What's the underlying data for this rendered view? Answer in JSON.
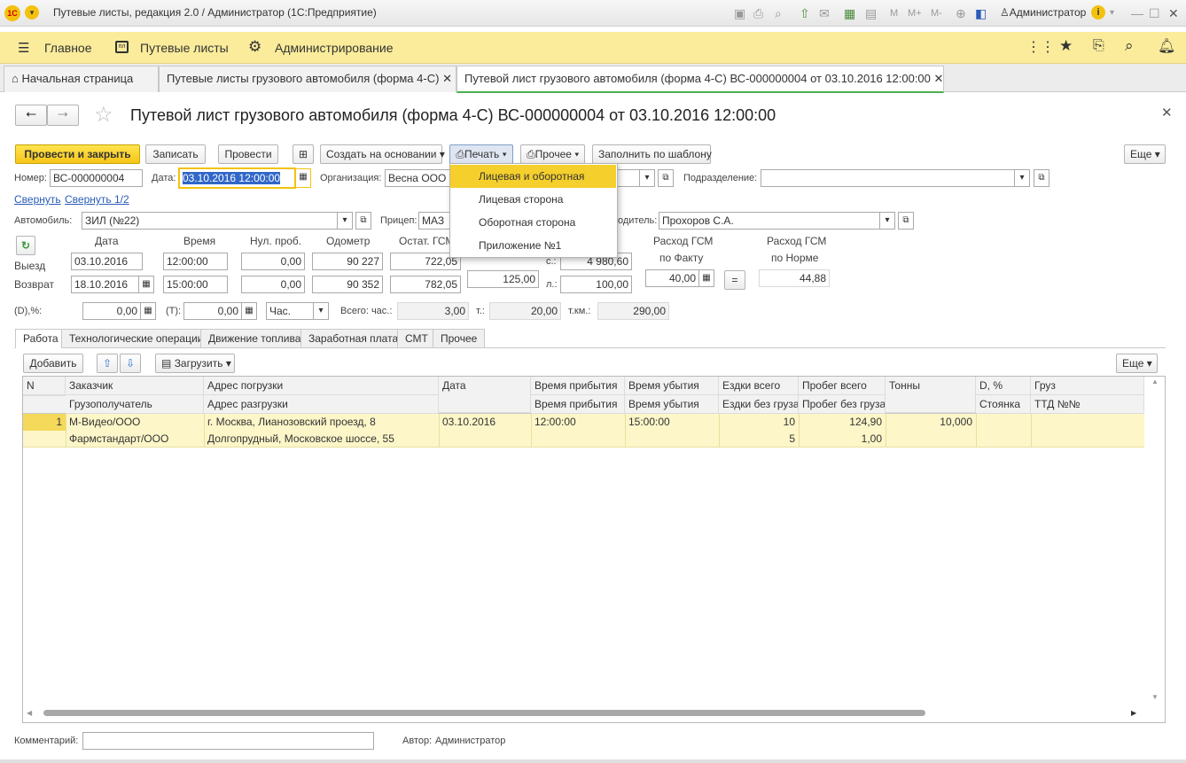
{
  "window": {
    "title": "Путевые листы, редакция 2.0 / Администратор (1С:Предприятие)",
    "user": "Администратор",
    "app_logo": "1С"
  },
  "menu": {
    "items": [
      "Главное",
      "Путевые листы",
      "Администрирование"
    ]
  },
  "tabs": {
    "home": "Начальная страница",
    "t1": "Путевые листы грузового автомобиля (форма 4-С)",
    "t2": "Путевой лист грузового автомобиля (форма 4-С) ВС-000000004 от 03.10.2016 12:00:00"
  },
  "doc": {
    "title": "Путевой лист грузового автомобиля (форма 4-С) ВС-000000004 от 03.10.2016 12:00:00"
  },
  "toolbar": {
    "post_close": "Провести и закрыть",
    "save": "Записать",
    "post": "Провести",
    "create_based": "Создать на основании",
    "print": "Печать",
    "other": "Прочее",
    "fill_template": "Заполнить по шаблону",
    "more": "Еще"
  },
  "print_menu": {
    "items": [
      "Лицевая и оборотная",
      "Лицевая сторона",
      "Оборотная сторона",
      "Приложение №1"
    ]
  },
  "fields": {
    "number_label": "Номер:",
    "number": "ВС-000000004",
    "date_label": "Дата:",
    "date": "03.10.2016 12:00:00",
    "org_label": "Организация:",
    "org": "Весна ООО",
    "dept_label": "Подразделение:",
    "dept": "",
    "collapse": "Свернуть",
    "collapse_half": "Свернуть 1/2",
    "car_label": "Автомобиль:",
    "car": "ЗИЛ (№22)",
    "trailer_label": "Прицеп:",
    "trailer": "МАЗ",
    "driver_label": "одитель:",
    "driver": "Прохоров С.А."
  },
  "trip": {
    "h_date": "Дата",
    "h_time": "Время",
    "h_zero": "Нул. проб.",
    "h_odo": "Одометр",
    "h_fuel": "Остат. ГСМ",
    "h_fact1": "Расход ГСМ",
    "h_fact2": "по Факту",
    "h_norm1": "Расход ГСМ",
    "h_norm2": "по Норме",
    "out_label": "Выезд",
    "out_date": "03.10.2016",
    "out_time": "12:00:00",
    "out_zero": "0,00",
    "out_odo": "90 227",
    "out_fuel": "722,05",
    "ret_label": "Возврат",
    "ret_date": "18.10.2016",
    "ret_time": "15:00:00",
    "ret_zero": "0,00",
    "ret_odo": "90 352",
    "ret_fuel": "782,05",
    "mid_val": "125,00",
    "s_label": "с.:",
    "s_val": "4 980,60",
    "l_label": "л.:",
    "l_val": "100,00",
    "fact_val": "40,00",
    "eq": "=",
    "norm_val": "44,88"
  },
  "summary": {
    "d_label": "(D),%:",
    "d_val": "0,00",
    "t_label": "(T):",
    "t_val": "0,00",
    "unit": "Час.",
    "hours_label": "Всего: час.:",
    "hours": "3,00",
    "t2_label": "т.:",
    "t2": "20,00",
    "tkm_label": "т.км.:",
    "tkm": "290,00"
  },
  "page_tabs": [
    "Работа",
    "Технологические операции",
    "Движение топлива",
    "Заработная плата",
    "СМТ",
    "Прочее"
  ],
  "table_toolbar": {
    "add": "Добавить",
    "load": "Загрузить",
    "more": "Еще"
  },
  "table": {
    "h1": [
      "N",
      "Заказчик",
      "Адрес погрузки",
      "Дата",
      "Время прибытия",
      "Время убытия",
      "Ездки всего",
      "Пробег всего",
      "Тонны",
      "D, %",
      "Груз"
    ],
    "h2": [
      "",
      "Грузополучатель",
      "Адрес разгрузки",
      "",
      "Время прибытия",
      "Время убытия",
      "Ездки без груза",
      "Пробег без груза",
      "",
      "Стоянка",
      "ТТД №№"
    ],
    "r1": [
      "1",
      "М-Видео/ООО",
      "г. Москва, Лианозовский проезд, 8",
      "03.10.2016",
      "12:00:00",
      "15:00:00",
      "10",
      "124,90",
      "10,000",
      "",
      ""
    ],
    "r2": [
      "",
      "Фармстандарт/ООО",
      "Долгопрудный, Московское шоссе, 55",
      "",
      "",
      "",
      "5",
      "1,00",
      "",
      "",
      ""
    ]
  },
  "footer": {
    "comment_label": "Комментарий:",
    "comment": "",
    "author_label": "Автор:",
    "author": "Администратор"
  },
  "colors": {
    "accent_yellow": "#fbec9b",
    "selected_row": "#fdf6c8",
    "active_tab_underline": "#4caf50",
    "link": "#2a5bb8"
  }
}
